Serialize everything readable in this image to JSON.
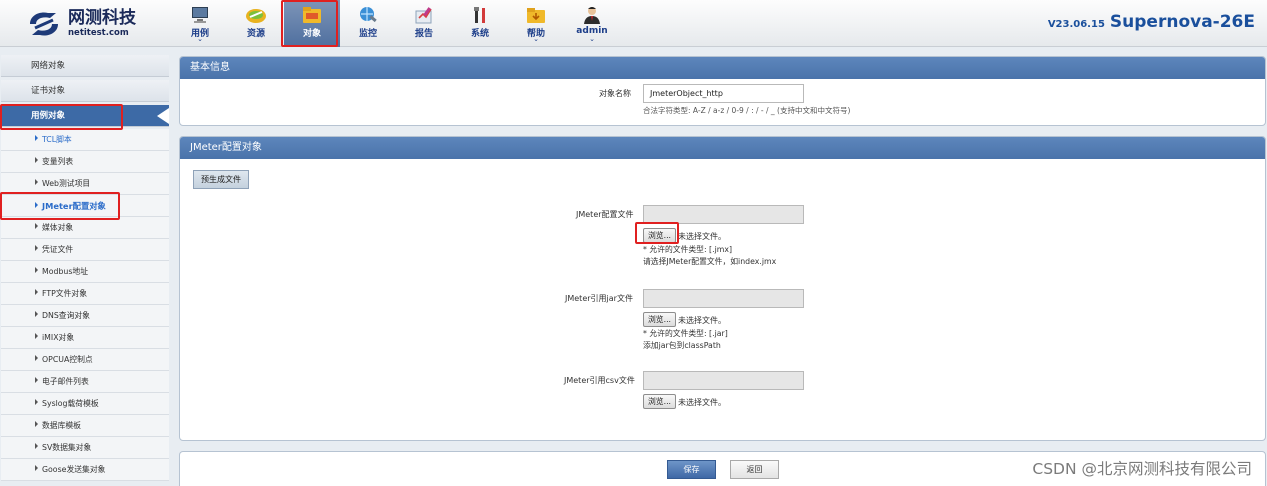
{
  "brand": {
    "name_cn": "网测科技",
    "name_en": "netitest.com"
  },
  "nav": [
    {
      "label": "用例",
      "icon": "monitor-icon",
      "chevron": true
    },
    {
      "label": "资源",
      "icon": "resource-icon",
      "chevron": false
    },
    {
      "label": "对象",
      "icon": "object-folder-icon",
      "chevron": false,
      "active": true
    },
    {
      "label": "监控",
      "icon": "monitor-globe-icon",
      "chevron": false
    },
    {
      "label": "报告",
      "icon": "report-icon",
      "chevron": false
    },
    {
      "label": "系统",
      "icon": "tools-icon",
      "chevron": false
    },
    {
      "label": "帮助",
      "icon": "help-folder-icon",
      "chevron": true
    },
    {
      "label": "admin",
      "icon": "user-icon",
      "chevron": true
    }
  ],
  "version": {
    "number": "V23.06.15",
    "model": "Supernova-26E"
  },
  "sidebar": {
    "categories": [
      "网络对象",
      "证书对象",
      "用例对象"
    ],
    "items": [
      "TCL脚本",
      "变量列表",
      "Web测试项目",
      "JMeter配置对象",
      "媒体对象",
      "凭证文件",
      "Modbus地址",
      "FTP文件对象",
      "DNS查询对象",
      "iMIX对象",
      "OPCUA控制点",
      "电子邮件列表",
      "Syslog载荷模板",
      "数据库模板",
      "SV数据集对象",
      "Goose发送集对象"
    ]
  },
  "basic": {
    "title": "基本信息",
    "name_label": "对象名称",
    "name_value": "JmeterObject_http",
    "name_hint": "合法字符类型: A-Z / a-z / 0-9 / : / - / _ (支持中文和中文符号)"
  },
  "jmeter": {
    "title": "JMeter配置对象",
    "pregen_button": "预生成文件",
    "config_label": "JMeter配置文件",
    "browse": "浏览...",
    "no_file": "未选择文件。",
    "config_allowed": "* 允许的文件类型: [.jmx]",
    "config_desc": "请选择JMeter配置文件，如index.jmx",
    "jar_label": "JMeter引用jar文件",
    "jar_allowed": "* 允许的文件类型: [.jar]",
    "jar_desc": "添加jar包到classPath",
    "csv_label": "JMeter引用csv文件"
  },
  "footer": {
    "save": "保存",
    "back": "返回"
  },
  "watermark": "CSDN @北京网测科技有限公司",
  "colors": {
    "header_blue": "#4f78b0",
    "highlight_red": "#e02020",
    "sidebar_active": "#3d6aa6"
  }
}
